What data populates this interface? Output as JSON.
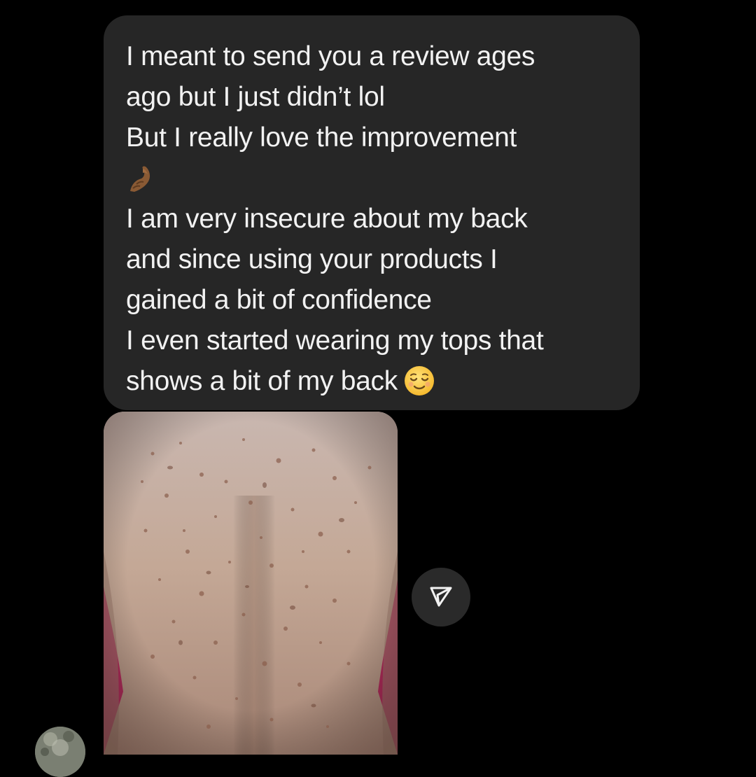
{
  "message": {
    "lines": [
      "I meant to send you a review ages",
      "ago but I just didn’t lol",
      "But I really love the improvement",
      "I am very insecure about my back",
      "and since using your products I",
      "gained a bit of confidence",
      "I even started wearing my tops that",
      "shows a bit of my back"
    ],
    "emojis": {
      "after_line_3": "pinched-fingers-emoji",
      "end_of_message": "relieved-face-emoji"
    }
  },
  "attachment": {
    "type": "photo"
  },
  "actions": {
    "share_icon": "send-arrow-icon"
  },
  "sender": {
    "avatar_icon": "avatar"
  },
  "colors": {
    "background": "#000000",
    "bubble": "#262626",
    "text": "#f2f2f2",
    "share_button": "#2a2a2a"
  }
}
